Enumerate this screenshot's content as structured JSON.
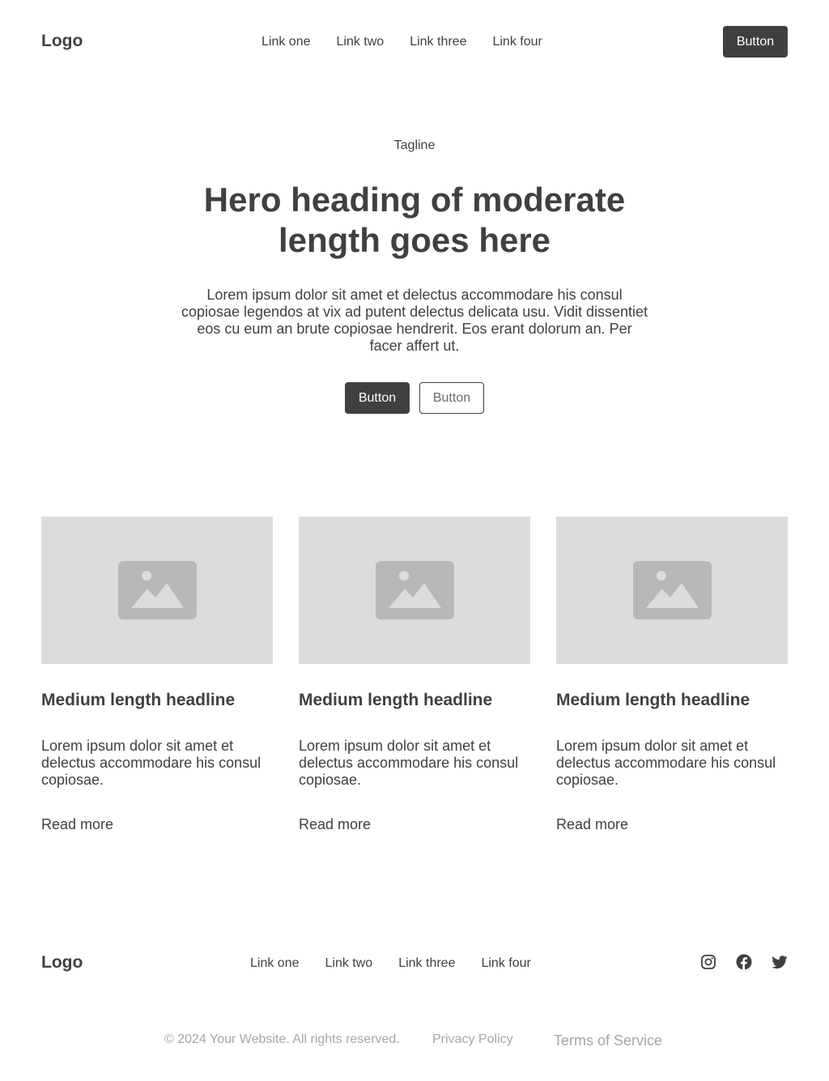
{
  "header": {
    "logo": "Logo",
    "nav": [
      "Link one",
      "Link two",
      "Link three",
      "Link four"
    ],
    "button_label": "Button"
  },
  "hero": {
    "tagline": "Tagline",
    "heading": "Hero heading of moderate length goes here",
    "text": "Lorem ipsum dolor sit amet et delectus accommodare his consul copiosae legendos at vix ad putent delectus delicata usu. Vidit dissentiet eos cu eum an brute copiosae hendrerit. Eos erant dolorum an. Per facer affert ut.",
    "primary_button": "Button",
    "secondary_button": "Button"
  },
  "cards": [
    {
      "image_icon": "image-placeholder-icon",
      "title": "Medium length headline",
      "text": "Lorem ipsum dolor sit amet et delectus accommodare his consul copiosae.",
      "link": "Read more"
    },
    {
      "image_icon": "image-placeholder-icon",
      "title": "Medium length headline",
      "text": "Lorem ipsum dolor sit amet et delectus accommodare his consul copiosae.",
      "link": "Read more"
    },
    {
      "image_icon": "image-placeholder-icon",
      "title": "Medium length headline",
      "text": "Lorem ipsum dolor sit amet et delectus accommodare his consul copiosae.",
      "link": "Read more"
    }
  ],
  "footer": {
    "logo": "Logo",
    "nav": [
      "Link one",
      "Link two",
      "Link three",
      "Link four"
    ],
    "social": [
      "instagram-icon",
      "facebook-icon",
      "twitter-icon"
    ],
    "copyright": "© 2024 Your Website. All rights reserved.",
    "privacy": "Privacy Policy",
    "terms": "Terms of Service"
  },
  "colors": {
    "text": "#404040",
    "button_bg": "#404040",
    "placeholder_bg": "#dcdcdc",
    "placeholder_icon": "#b8b8b8",
    "muted": "#a6a6a6"
  }
}
